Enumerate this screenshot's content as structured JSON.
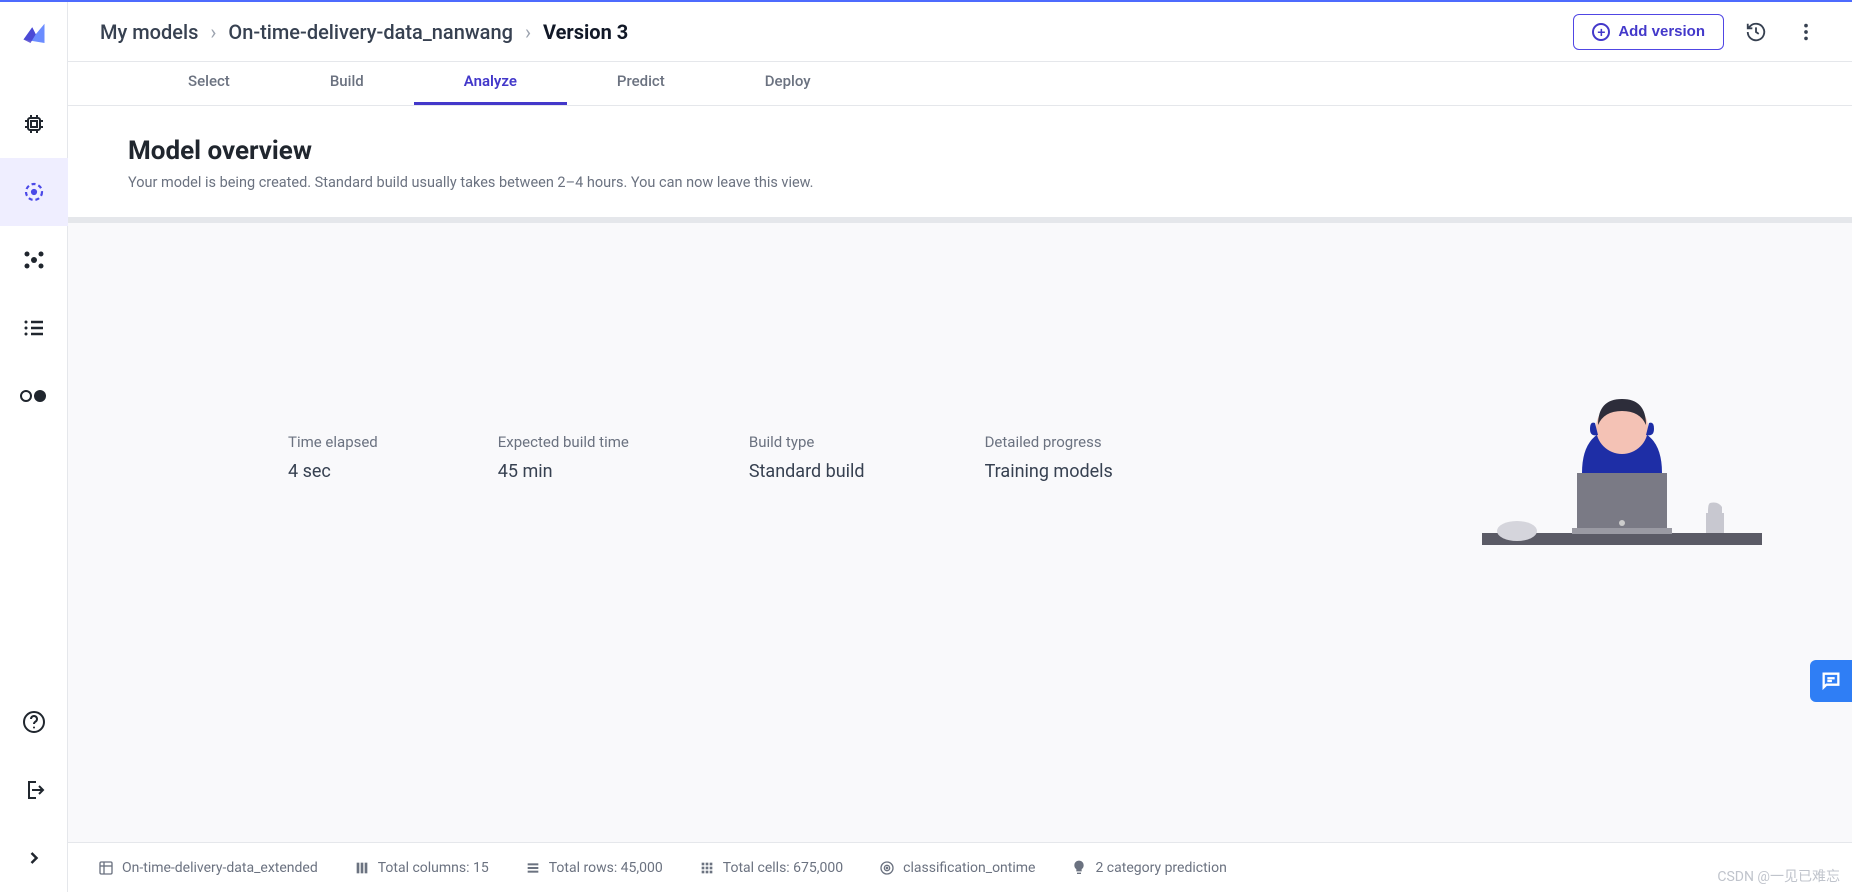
{
  "breadcrumbs": {
    "root": "My models",
    "project": "On-time-delivery-data_nanwang",
    "version": "Version 3"
  },
  "actions": {
    "add_version": "Add version"
  },
  "tabs": {
    "select": "Select",
    "build": "Build",
    "analyze": "Analyze",
    "predict": "Predict",
    "deploy": "Deploy"
  },
  "overview": {
    "title": "Model overview",
    "subtitle": "Your model is being created. Standard build usually takes between 2–4 hours. You can now leave this view."
  },
  "stats": {
    "time_elapsed_label": "Time elapsed",
    "time_elapsed_value": "4 sec",
    "expected_label": "Expected build time",
    "expected_value": "45 min",
    "build_type_label": "Build type",
    "build_type_value": "Standard build",
    "progress_label": "Detailed progress",
    "progress_value": "Training models"
  },
  "footer": {
    "dataset": "On-time-delivery-data_extended",
    "columns": "Total columns: 15",
    "rows": "Total rows: 45,000",
    "cells": "Total cells: 675,000",
    "target": "classification_ontime",
    "prediction": "2 category prediction"
  },
  "watermark": "CSDN @一见已难忘"
}
